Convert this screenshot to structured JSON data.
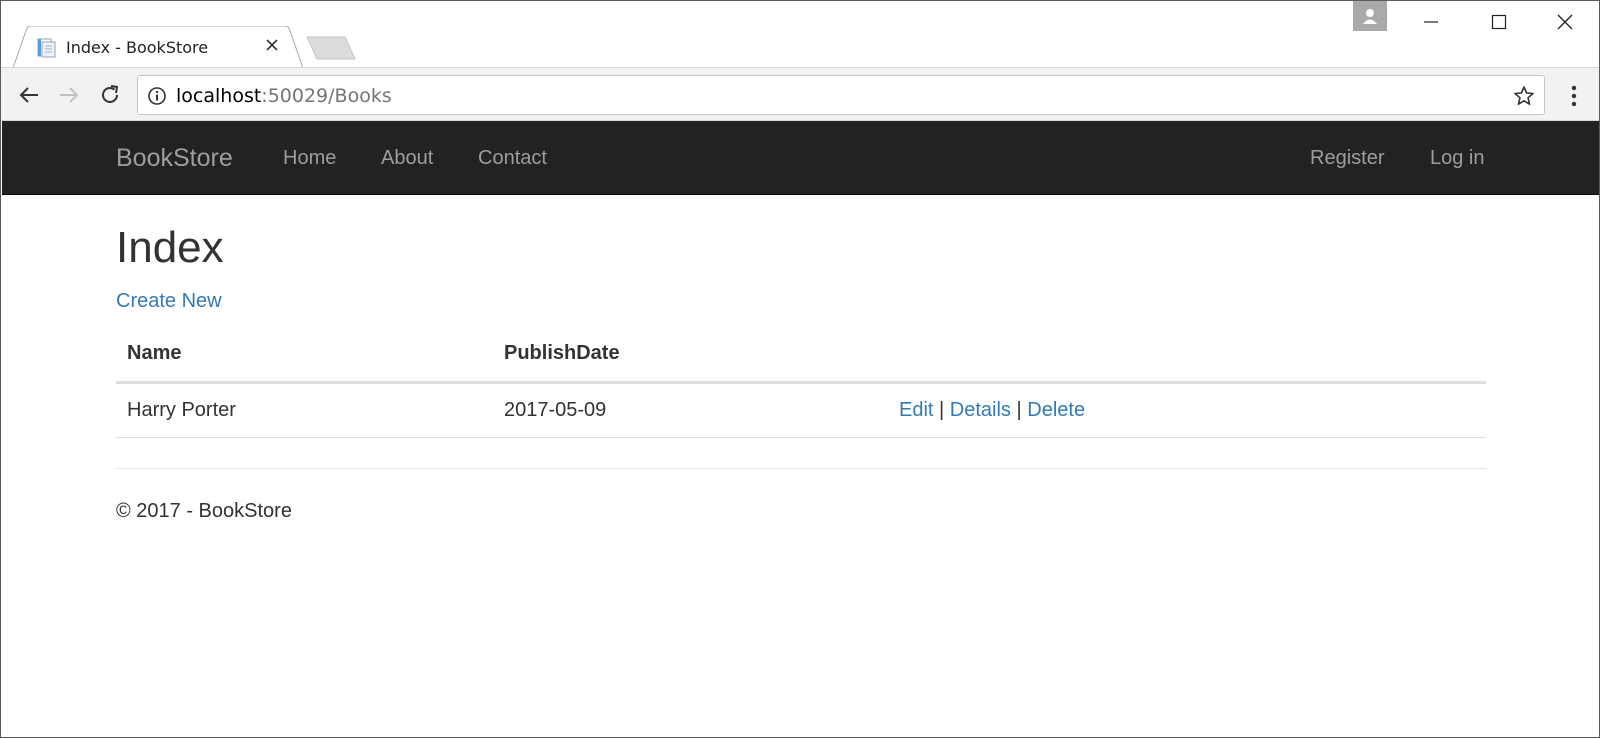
{
  "browser": {
    "tab": {
      "title": "Index - BookStore",
      "favicon": "page-icon"
    },
    "address": {
      "host": "localhost",
      "path": ":50029/Books"
    }
  },
  "navbar": {
    "brand": "BookStore",
    "links": [
      "Home",
      "About",
      "Contact"
    ],
    "right_links": [
      "Register",
      "Log in"
    ],
    "background": "#222222",
    "link_color": "#9d9d9d"
  },
  "page": {
    "title": "Index",
    "create_link": "Create New",
    "link_color": "#337ab7"
  },
  "table": {
    "headers": [
      "Name",
      "PublishDate",
      ""
    ],
    "rows": [
      {
        "name": "Harry Porter",
        "publish_date": "2017-05-09",
        "actions": [
          "Edit",
          "Details",
          "Delete"
        ],
        "separator": "|"
      }
    ]
  },
  "footer": {
    "text": "© 2017 - BookStore"
  }
}
